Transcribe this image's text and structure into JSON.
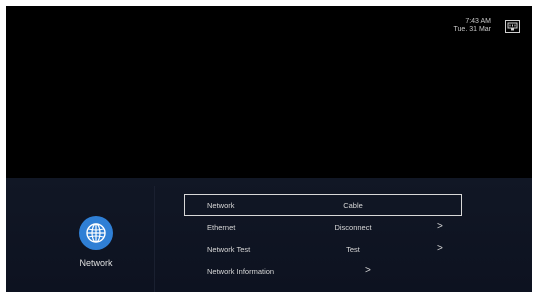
{
  "status": {
    "time": "7:43 AM",
    "date": "Tue. 31 Mar",
    "connection_icon": "wired-network-icon"
  },
  "category": {
    "icon": "globe-icon",
    "label": "Network",
    "icon_color": "#2f7fd5"
  },
  "menu": {
    "items": [
      {
        "label": "Network",
        "value": "Cable",
        "arrow": ""
      },
      {
        "label": "Ethernet",
        "value": "Disconnect",
        "arrow": ">"
      },
      {
        "label": "Network Test",
        "value": "Test",
        "arrow": ">"
      },
      {
        "label": "Network Information",
        "value": "",
        "arrow": ">"
      }
    ]
  }
}
